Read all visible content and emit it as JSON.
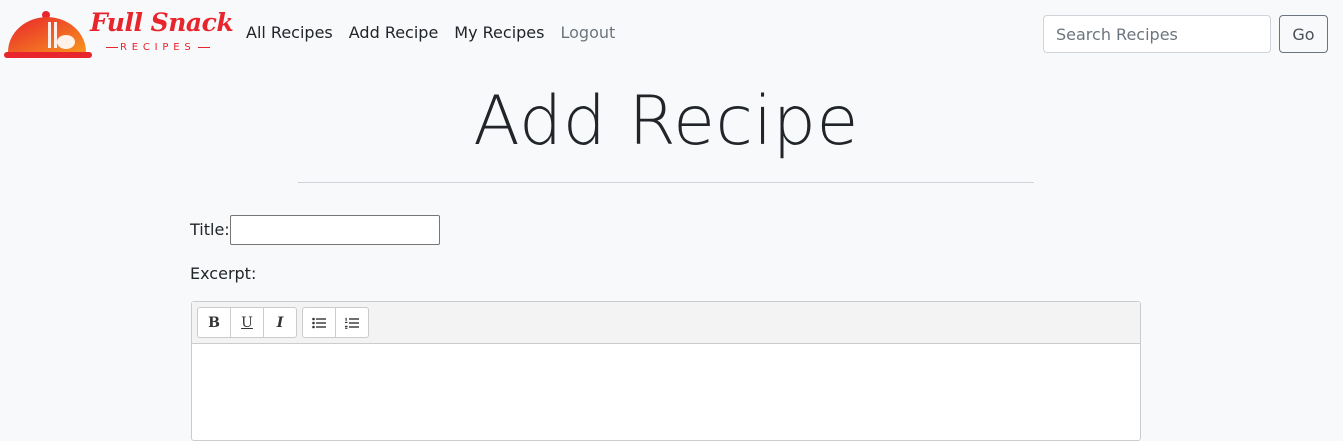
{
  "brand": {
    "name": "Full Snack",
    "tagline": "RECIPES"
  },
  "nav": {
    "links": [
      "All Recipes",
      "Add Recipe",
      "My Recipes",
      "Logout"
    ]
  },
  "search": {
    "placeholder": "Search Recipes",
    "value": "",
    "button_label": "Go"
  },
  "page": {
    "title": "Add Recipe"
  },
  "form": {
    "title_label": "Title:",
    "title_value": "",
    "excerpt_label": "Excerpt:",
    "toolbar": {
      "bold": "B",
      "underline": "U",
      "italic": "I",
      "bullet_list_icon": "unordered-list-icon",
      "ordered_list_icon": "ordered-list-icon"
    }
  },
  "colors": {
    "brand_red": "#e8242c",
    "brand_orange": "#f7931e",
    "background": "#f8f9fa"
  }
}
